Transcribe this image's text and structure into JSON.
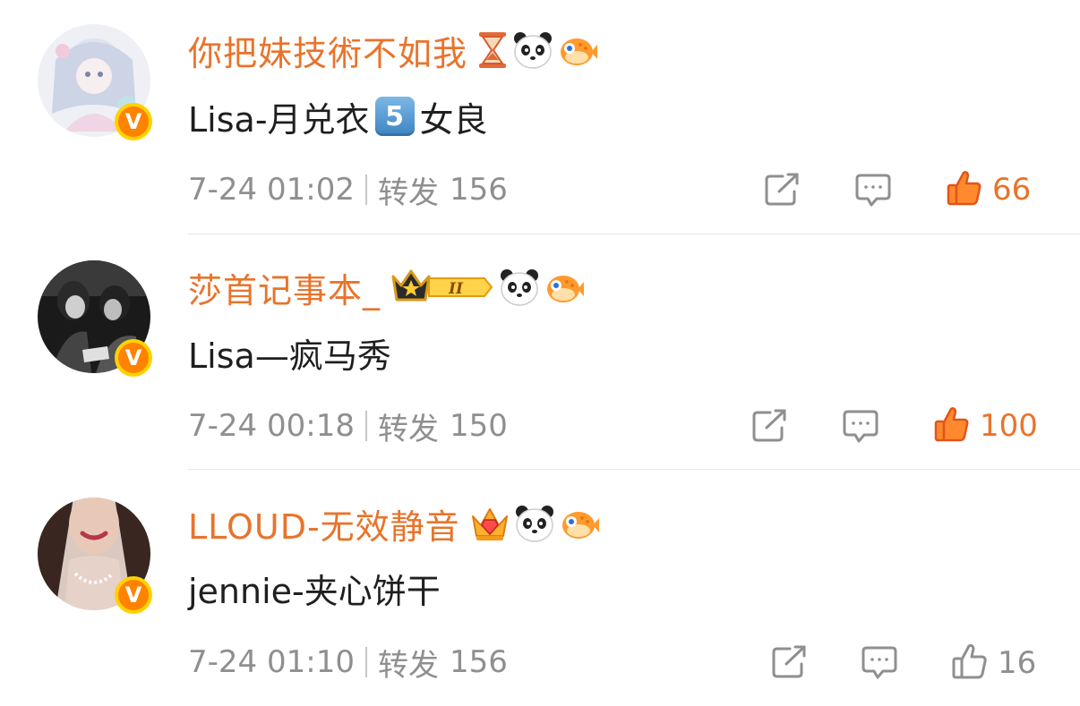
{
  "colors": {
    "username": "#e8742b",
    "text": "#1f1f1f",
    "meta": "#8f8f8f",
    "verified_badge": "#ff8200",
    "like_active": "#ff6b1a"
  },
  "comments": [
    {
      "username": "你把妹技術不如我",
      "badges": [
        "hourglass-icon",
        "panda-icon",
        "pufferfish-icon"
      ],
      "text_before": "Lisa-月兑衣",
      "keycap": "5",
      "text_after": "女良",
      "time": "7-24 01:02",
      "forward_label": "转发",
      "forward_count": "156",
      "likes": "66",
      "liked": true,
      "verified": "V"
    },
    {
      "username": "莎首记事本_",
      "badges": [
        "crown-level-ii-icon",
        "panda-icon",
        "pufferfish-icon"
      ],
      "level_badge": "II",
      "text": "Lisa—疯马秀",
      "time": "7-24 00:18",
      "forward_label": "转发",
      "forward_count": "150",
      "likes": "100",
      "liked": true,
      "verified": "V"
    },
    {
      "username": "LLOUD-无效静音",
      "badges": [
        "gem-crown-icon",
        "panda-icon",
        "pufferfish-icon"
      ],
      "text": "jennie-夹心饼干",
      "time": "7-24 01:10",
      "forward_label": "转发",
      "forward_count": "156",
      "likes": "16",
      "liked": false,
      "verified": "V"
    }
  ]
}
